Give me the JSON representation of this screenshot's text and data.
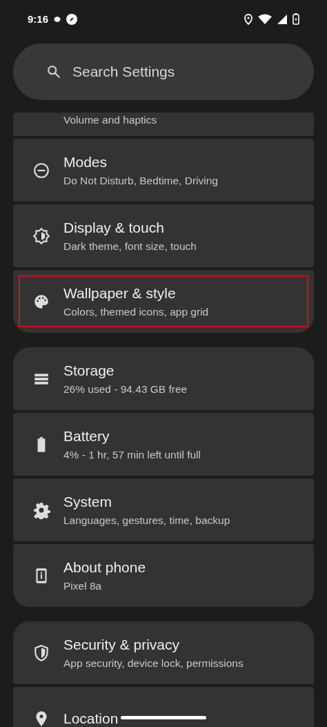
{
  "status_bar": {
    "time": "9:16"
  },
  "search": {
    "placeholder": "Search Settings"
  },
  "groups": [
    {
      "items": [
        {
          "subtitle": "Volume and haptics",
          "highlighted": false,
          "partial": true
        },
        {
          "title": "Modes",
          "subtitle": "Do Not Disturb, Bedtime, Driving",
          "highlighted": false
        },
        {
          "title": "Display & touch",
          "subtitle": "Dark theme, font size, touch",
          "highlighted": false
        },
        {
          "title": "Wallpaper & style",
          "subtitle": "Colors, themed icons, app grid",
          "highlighted": true
        }
      ]
    },
    {
      "items": [
        {
          "title": "Storage",
          "subtitle": "26% used - 94.43 GB free",
          "highlighted": false
        },
        {
          "title": "Battery",
          "subtitle": "4% - 1 hr, 57 min left until full",
          "highlighted": false
        },
        {
          "title": "System",
          "subtitle": "Languages, gestures, time, backup",
          "highlighted": false
        },
        {
          "title": "About phone",
          "subtitle": "Pixel 8a",
          "highlighted": false
        }
      ]
    },
    {
      "items": [
        {
          "title": "Security & privacy",
          "subtitle": "App security, device lock, permissions",
          "highlighted": false
        },
        {
          "title": "Location",
          "highlighted": false
        }
      ]
    }
  ]
}
